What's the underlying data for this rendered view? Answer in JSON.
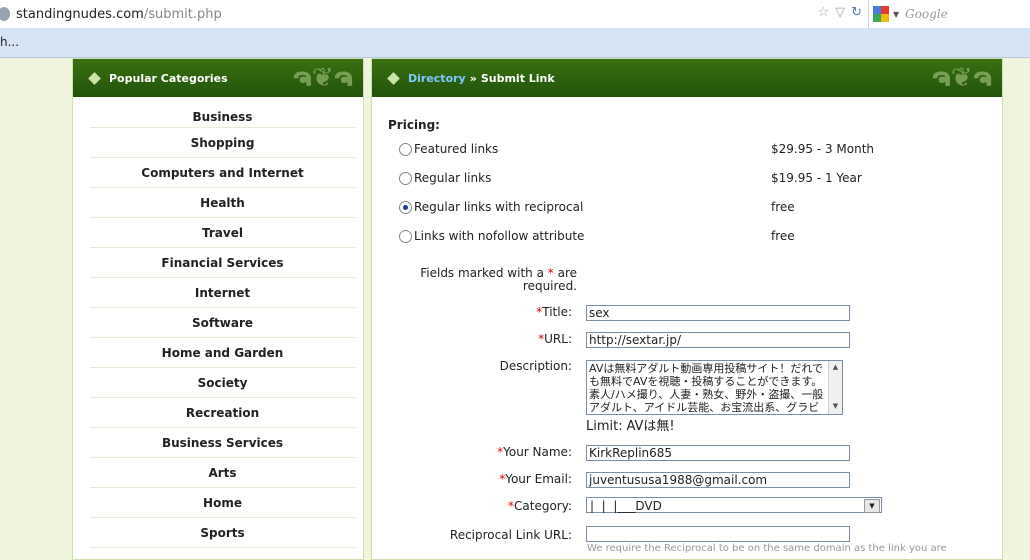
{
  "browser": {
    "url_domain": "standingnudes.com",
    "url_path": "/submit.php",
    "search_placeholder": "Google",
    "bookmark_text": "h..."
  },
  "sidebar": {
    "title": "Popular Categories",
    "items": [
      "Business",
      "Shopping",
      "Computers and Internet",
      "Health",
      "Travel",
      "Financial Services",
      "Internet",
      "Software",
      "Home and Garden",
      "Society",
      "Recreation",
      "Business Services",
      "Arts",
      "Home",
      "Sports"
    ]
  },
  "main": {
    "breadcrumb_link": "Directory",
    "breadcrumb_sep": "»",
    "breadcrumb_current": "Submit Link",
    "pricing_title": "Pricing:",
    "pricing": [
      {
        "label": "Featured links",
        "price": "$29.95 - 3 Month",
        "selected": false
      },
      {
        "label": "Regular links",
        "price": "$19.95 - 1 Year",
        "selected": false
      },
      {
        "label": "Regular links with reciprocal",
        "price": "free",
        "selected": true
      },
      {
        "label": "Links with nofollow attribute",
        "price": "free",
        "selected": false
      }
    ],
    "required_note_pre": "Fields marked with a",
    "required_star": "*",
    "required_note_post_1": "are",
    "required_note_post_2": "required.",
    "fields": {
      "title_label": "Title:",
      "title_value": "sex",
      "url_label": "URL:",
      "url_value": "http://sextar.jp/",
      "description_label": "Description:",
      "description_value": "AVは無料アダルト動画専用投稿サイト！だれでも無料でAVを視聴・投稿することができます。素人/ハメ撮り、人妻・熟女、野外・盗撮、一般アダルト、アイドル芸能、お宝流出系、グラビア系、女子高生、ア",
      "limit_label": "Limit:",
      "limit_value": "AVは無!",
      "name_label": "Your Name:",
      "name_value": "KirkReplin685",
      "email_label": "Your Email:",
      "email_value": "juventususa1988@gmail.com",
      "category_label": "Category:",
      "category_value": "|  |  |___DVD",
      "reciprocal_label": "Reciprocal Link URL:",
      "reciprocal_value": ""
    },
    "reciprocal_note": "We require the Reciprocal to be on the same domain as the link you are"
  },
  "colors": {
    "header_green": "#2b5e0c",
    "page_bg": "#eef5dc",
    "link_blue": "#7ec6ff",
    "required_red": "#dd0000"
  }
}
